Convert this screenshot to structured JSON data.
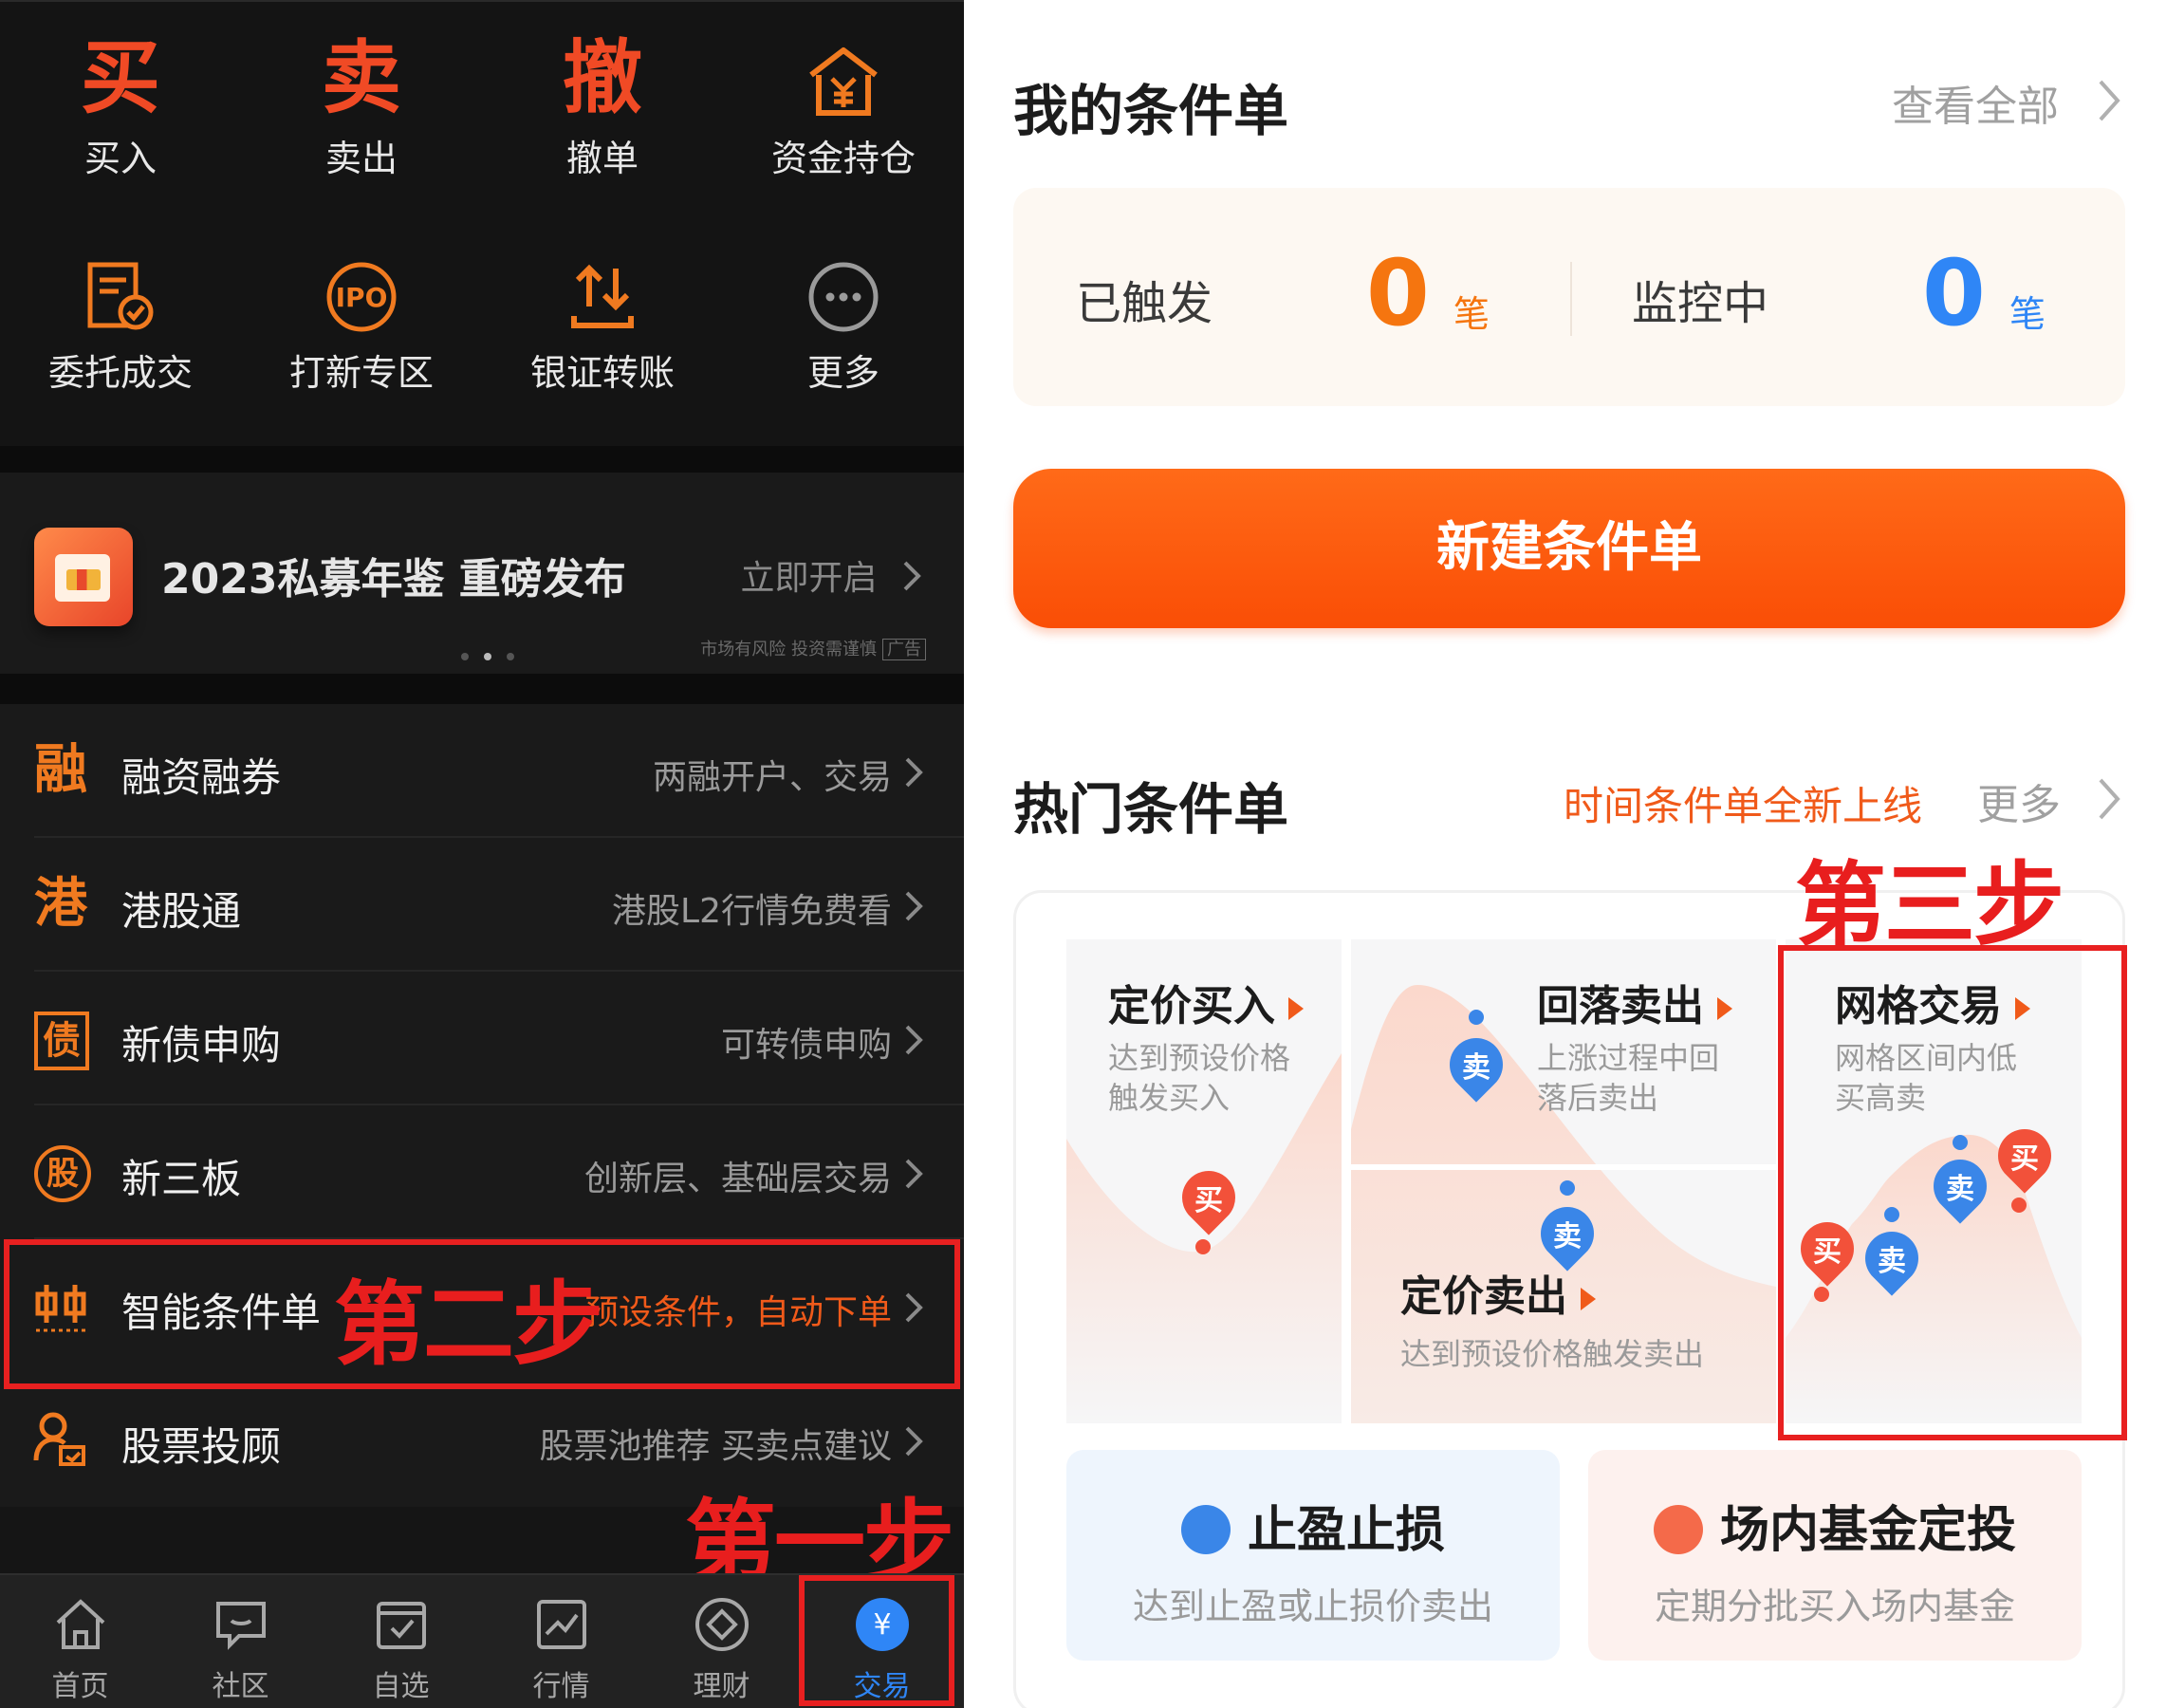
{
  "left": {
    "quick_actions": [
      {
        "label": "买入",
        "glyph": "买",
        "icon": "buy-char-icon"
      },
      {
        "label": "卖出",
        "glyph": "卖",
        "icon": "sell-char-icon"
      },
      {
        "label": "撤单",
        "glyph": "撤",
        "icon": "cancel-char-icon"
      },
      {
        "label": "资金持仓",
        "icon": "funds-position-icon"
      },
      {
        "label": "委托成交",
        "icon": "order-deal-icon"
      },
      {
        "label": "打新专区",
        "icon": "ipo-icon",
        "badge": "IPO"
      },
      {
        "label": "银证转账",
        "icon": "bank-transfer-icon"
      },
      {
        "label": "更多",
        "icon": "more-icon"
      }
    ],
    "banner": {
      "title": "2023私募年鉴 重磅发布",
      "link": "立即开启",
      "note": "市场有风险 投资需谨慎",
      "ad_tag": "广告"
    },
    "menu": [
      {
        "icon_char": "融",
        "label": "融资融券",
        "desc": "两融开户、交易"
      },
      {
        "icon_char": "港",
        "label": "港股通",
        "desc": "港股L2行情免费看"
      },
      {
        "icon_char": "债",
        "label": "新债申购",
        "desc": "可转债申购"
      },
      {
        "icon_char": "股",
        "label": "新三板",
        "desc": "创新层、基础层交易"
      },
      {
        "icon_char": "",
        "label": "智能条件单",
        "desc": "预设条件，自动下单"
      },
      {
        "icon_char": "",
        "label": "股票投顾",
        "desc": "股票池推荐 买卖点建议"
      }
    ],
    "bottom_nav": [
      {
        "label": "首页",
        "icon": "home-icon"
      },
      {
        "label": "社区",
        "icon": "community-icon"
      },
      {
        "label": "自选",
        "icon": "watchlist-icon"
      },
      {
        "label": "行情",
        "icon": "market-icon"
      },
      {
        "label": "理财",
        "icon": "wealth-icon"
      },
      {
        "label": "交易",
        "icon": "trade-yen-icon",
        "glyph": "¥"
      }
    ],
    "steps": {
      "step1": "第一步",
      "step2": "第二步"
    }
  },
  "right": {
    "my_orders": {
      "title": "我的条件单",
      "view_all": "查看全部",
      "triggered_label": "已触发",
      "triggered_count": "0",
      "monitoring_label": "监控中",
      "monitoring_count": "0",
      "unit": "笔"
    },
    "new_button": "新建条件单",
    "hot": {
      "title": "热门条件单",
      "promo": "时间条件单全新上线",
      "more": "更多",
      "step3": "第三步",
      "price_buy": {
        "title": "定价买入",
        "desc1": "达到预设价格",
        "desc2": "触发买入"
      },
      "fall_sell": {
        "title": "回落卖出",
        "desc1": "上涨过程中回",
        "desc2": "落后卖出"
      },
      "price_sell": {
        "title": "定价卖出",
        "desc": "达到预设价格触发卖出"
      },
      "grid": {
        "title": "网格交易",
        "desc1": "网格区间内低",
        "desc2": "买高卖"
      },
      "pin_buy": "买",
      "pin_sell": "卖",
      "stop": {
        "title": "止盈止损",
        "desc": "达到止盈或止损价卖出"
      },
      "fund": {
        "title": "场内基金定投",
        "desc": "定期分批买入场内基金"
      }
    },
    "colors": {
      "accent": "#fa5008",
      "sell_blue": "#3a86e8",
      "buy_red": "#f2513a",
      "highlight_red": "#e82020"
    }
  }
}
